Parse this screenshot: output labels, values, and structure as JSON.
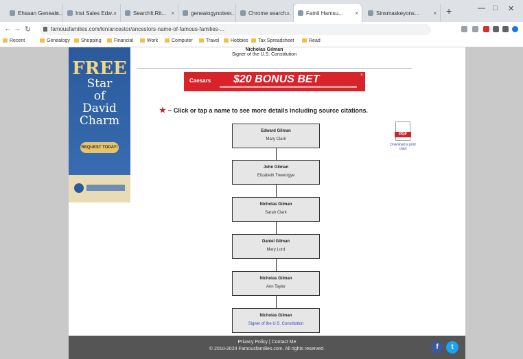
{
  "browser": {
    "tabs": [
      {
        "label": "Ehsaan Genealo..."
      },
      {
        "label": "Inst Sales Edw..."
      },
      {
        "label": "Searchlt.Rit..."
      },
      {
        "label": "genealogynotes..."
      },
      {
        "label": "Chrome search..."
      },
      {
        "label": "Famil Hamsu..."
      },
      {
        "label": "Sinsmaskeyons..."
      }
    ],
    "address": "famousfamilies.com/kin/ancestor/ancestors-name-of-famous-families-...",
    "bookmarks": [
      "Recent",
      "Genealogy",
      "Shopping",
      "Financial",
      "Work",
      "Computer",
      "Travel",
      "Hobbies",
      "Tax Spreadsheet",
      "Read"
    ]
  },
  "page": {
    "top_name": "Nicholas Gilman",
    "top_subtitle": "Signer of the U.S. Constitution",
    "ad": {
      "free": "FREE",
      "lines": [
        "Star",
        "of",
        "David",
        "Charm"
      ],
      "button": "REQUEST TODAY!"
    },
    "banner": {
      "brand": "Caesars",
      "amount": "$20 BONUS BET",
      "close": "×"
    },
    "instruction_star": "★",
    "instruction": "-- Click or tap a name to see more details including source citations.",
    "tree": [
      {
        "name": "Edward Gilman",
        "spouse": "Mary Clark"
      },
      {
        "name": "John Gilman",
        "spouse": "Elizabeth Treworgye"
      },
      {
        "name": "Nicholas Gilman",
        "spouse": "Sarah Clark"
      },
      {
        "name": "Daniel Gilman",
        "spouse": "Mary Lord"
      },
      {
        "name": "Nicholas Gilman",
        "spouse": "Ann Taylor"
      },
      {
        "name": "Nicholas Gilman",
        "spouse": "Signer of the U.S. Constitution"
      }
    ],
    "pdf": {
      "badge": "PDF",
      "caption": "Download a print chart"
    },
    "footer": {
      "line1": "Privacy Policy  |  Contact Me",
      "line2": "© 2010-2024 Famousfamilies.com. All rights reserved."
    }
  }
}
